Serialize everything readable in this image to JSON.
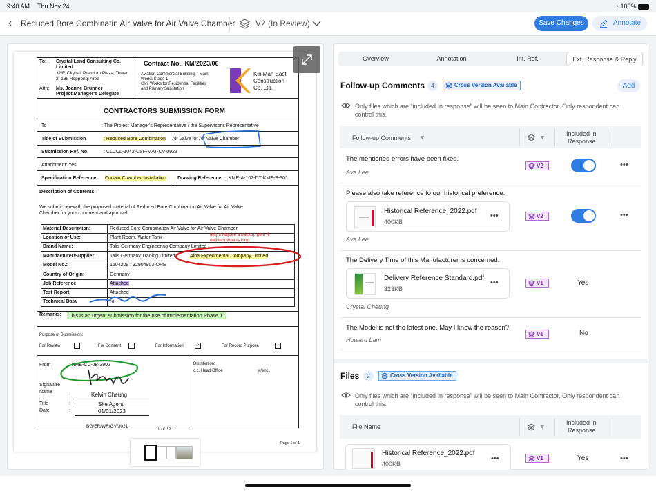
{
  "status": {
    "time": "9:40 AM",
    "date": "Thu Nov 24",
    "battery": "100%"
  },
  "header": {
    "title": "Reduced Bore Combinatin Air Valve for Air Valve Chamber",
    "version": "V2 (In Review)",
    "save_label": "Save Changes",
    "annotate_label": "Annotate"
  },
  "doc": {
    "to_label": "To:",
    "to_company_1": "Crystal Land Consulting Co.",
    "to_company_2": "Limited",
    "to_addr_1": "32/F, Cityhall Premium Plaza, Tower",
    "to_addr_2": "2, 138 Roppongi Area",
    "attn_label": "Attn:",
    "attn_name": "Ms. Joanne Brunner",
    "attn_role": "Project Manager's Delegate",
    "contract_no": "Contract No.: KM/2023/06",
    "contract_desc_1": "Aviation Commercial Building – Main",
    "contract_desc_2": "Works Stage 1",
    "contract_desc_3": "Civil Works for Residential Facilities",
    "contract_desc_4": "and Primary Substation",
    "company_1": "Kin Man East",
    "company_2": "Construction",
    "company_3": "Co. Ltd.",
    "form_title": "CONTRACTORS SUBMISSION FORM",
    "to2_label": "To",
    "to2_value": ": The Project Manager's Representative / the Supervisor's Representative",
    "tos_label": "Title of Submission",
    "tos_value_hl": ": Reduced Bore Combination",
    "tos_value_rest": " Air Valve for Air Valve Chamber",
    "ref_label": "Submission Ref. No.",
    "ref_value": ": CLCCL-1042-CSF-MAT-CV-0923",
    "attach_label": "Attachment: Yes",
    "spec_label": "Specification Reference:",
    "spec_value": "Curtain Chamber Installation",
    "draw_label": "Drawing Reference:",
    "draw_value": "KME-A-102-DT-KME-B-301",
    "desc_label": "Description of Contents:",
    "desc_1": "We submit herewith the proposed material of Reduced Bore Combination Air Valve for Air Valve",
    "desc_2": "Chamber for your comment and approval.",
    "mat_rows": [
      {
        "k": "Material Description:",
        "v": "Reduced Bore Combination Air Valve for Air Valve Chamber"
      },
      {
        "k": "Location of Use:",
        "v": "Plant Room, Water Tank"
      },
      {
        "k": "Brand Name:",
        "v": "Talis Germany Engineering Company Limited"
      },
      {
        "k": "Manufacturer/Supplier:",
        "v": "Talis Germany Trading Limited"
      },
      {
        "k": "Model No.:",
        "v": "1504209 ; 32904903-ORE"
      },
      {
        "k": "Country of Origin:",
        "v": "Germany"
      },
      {
        "k": "Job Reference:",
        "v": "Attached"
      },
      {
        "k": "Test Report:",
        "v": "Attached"
      },
      {
        "k": "Technical Data",
        "v": "Nil"
      }
    ],
    "alba": "Alba Experimental Company Limited",
    "red_note_1": "Might require a backup plan if",
    "red_note_2": "delivery time is long",
    "remarks_label": "Remarks:",
    "remarks_value": "This is an urgent submission for the use of implementation Phase 1.",
    "purpose_label": "Purpose of Submission:",
    "p1": "For Review",
    "p2": "For Consent",
    "p3": "For Information",
    "p4": "For Record Purpose",
    "check": "✓",
    "from_label": "From",
    "from_value": ": KME-CC-JB-3902",
    "sig_label": "Signature",
    "name_label": "Name",
    "name_value": "Kelvin Cheung",
    "title_label": "Title",
    "title_value": "Site Agent",
    "date_label": "Date",
    "date_value": "01/01/2023",
    "colon": ":",
    "dist_label": "Distribution:",
    "dist_value": "c.c.  Head Office",
    "wend": "w/encl.",
    "form_code": "BG/ER/WR/GV/3021",
    "page_indicator": "1 of 32",
    "page_of": "Page 1 of 1"
  },
  "tabs": [
    "Overview",
    "Annotation",
    "Int. Ref.",
    "Ext. Response & Reply"
  ],
  "followup": {
    "title": "Follow-up Comments",
    "count": "4",
    "cross": "Cross Version Available",
    "add": "Add",
    "note_1": "Only files which are “included In response” will be seen to Main Contractor. Only respondent can",
    "note_2": "control this.",
    "col_comments": "Follow-up Comments",
    "col_included_1": "Included in",
    "col_included_2": "Response",
    "rows": [
      {
        "text": "The mentioned errors have been fixed.",
        "author": "Ava Lee",
        "version": "V2"
      },
      {
        "text": "Please also take reference to our historical preference.",
        "author": "Ava Lee",
        "version": "V2",
        "file": "Historical Reference_2022.pdf",
        "size": "400KB"
      },
      {
        "text": "The Delivery Time of this Manufacturer is concerned.",
        "author": "Crystal Cheung",
        "version": "V1",
        "file": "Delivery Reference Standard.pdf",
        "size": "323KB",
        "included": "Yes"
      },
      {
        "text": "The Model is not the latest one. May I know the reason?",
        "author": "Howard Lam",
        "version": "V1",
        "included": "No"
      }
    ]
  },
  "files": {
    "title": "Files",
    "count": "2",
    "cross": "Cross Version Available",
    "note_1": "Only files which are “included In response” will be seen to Main Contractor. Only respondent can",
    "note_2": "control this.",
    "col_name": "File Name",
    "col_included_1": "Included in",
    "col_included_2": "Response",
    "rows": [
      {
        "file": "Historical Reference_2022.pdf",
        "size": "400KB",
        "version": "V1",
        "included": "Yes"
      }
    ]
  },
  "colors": {
    "accent": "#2f7de1",
    "version_badge": "#7d2fa6",
    "annotation_red": "#d92020",
    "annotation_blue": "#2a6fd6"
  }
}
